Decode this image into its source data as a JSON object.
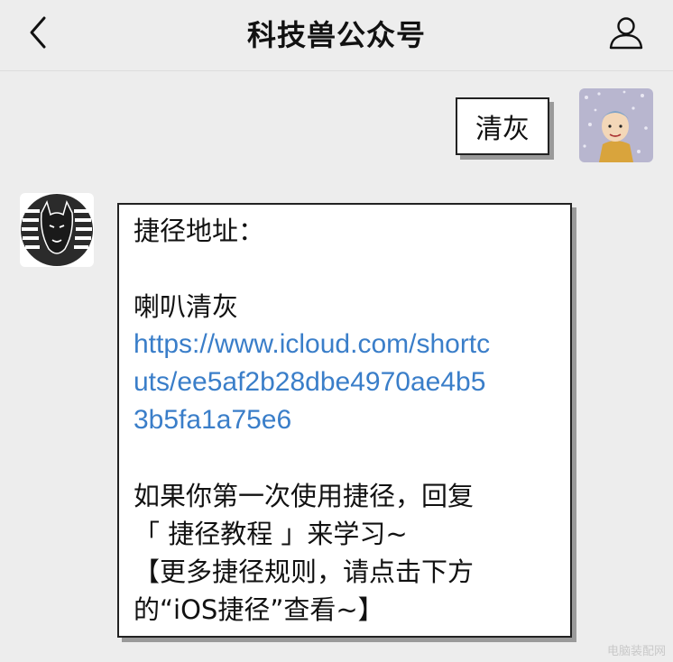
{
  "header": {
    "title": "科技兽公众号",
    "back_icon": "chevron-left-icon",
    "profile_icon": "user-icon"
  },
  "outgoing": {
    "text": "清灰"
  },
  "incoming": {
    "line1": "捷径地址：",
    "line2": "喇叭清灰",
    "link_line1": "https://www.icloud.com/shortc",
    "link_line2": "uts/ee5af2b28dbe4970ae4b5",
    "link_line3": "3b5fa1a75e6",
    "line3": "如果你第一次使用捷径，回复",
    "line4": "「 捷径教程 」来学习~",
    "line5": "【更多捷径规则，请点击下方",
    "line6": "的“iOS捷径”查看~】"
  },
  "colors": {
    "background": "#ededed",
    "link": "#3a7ec9",
    "bubble": "#ffffff"
  },
  "watermark": "电脑装配网"
}
